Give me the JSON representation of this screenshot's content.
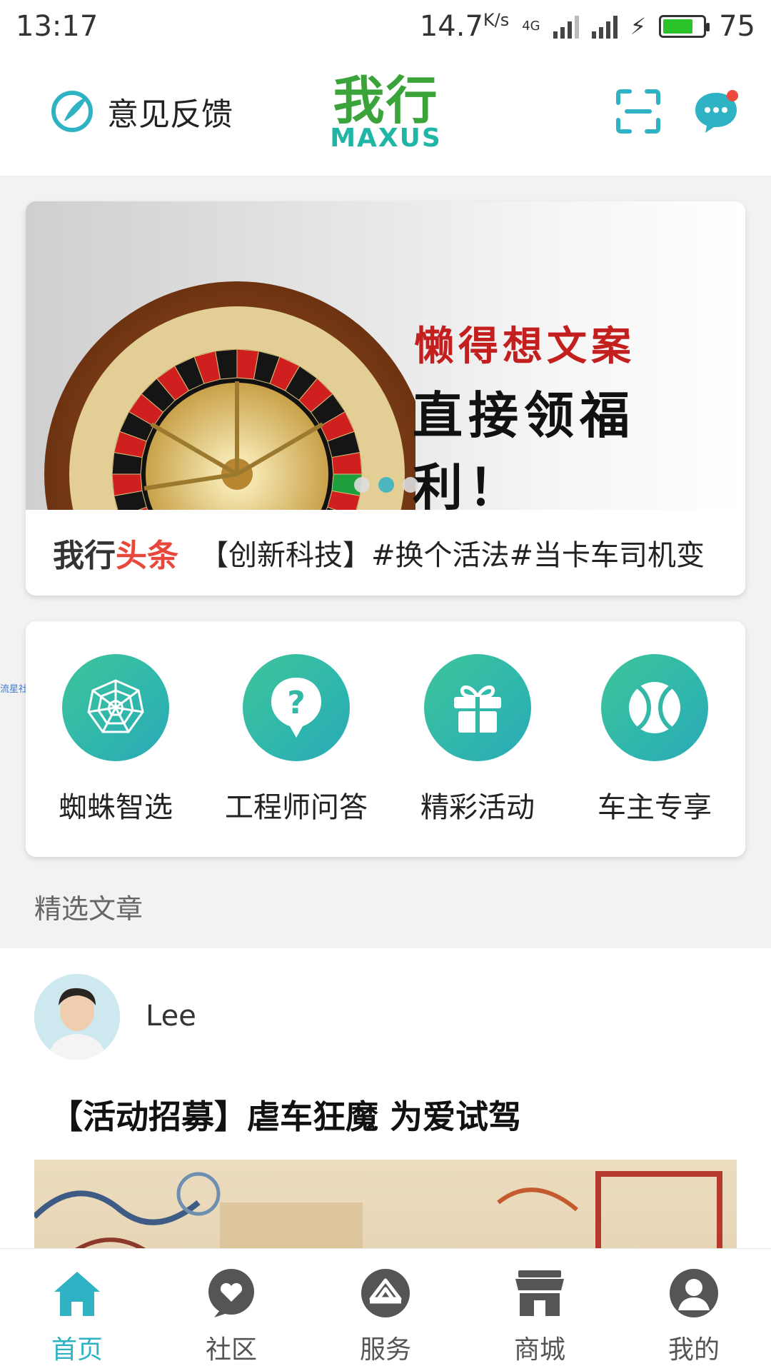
{
  "status_bar": {
    "time": "13:17",
    "net_speed": "14.7",
    "net_unit": "K/s",
    "network": "4G",
    "battery": "75",
    "battery_level": 0.75
  },
  "header": {
    "feedback_label": "意见反馈",
    "logo_cn": "我行",
    "logo_en": "MAXUS",
    "accent_color": "#2fb3c4"
  },
  "banner": {
    "line1": "懒得想文案",
    "line2": "直接领福利！",
    "active_slide": 1,
    "slide_count": 3,
    "headline_brand_1": "我行",
    "headline_brand_2": "头条",
    "headline_text": "【创新科技】#换个活法#当卡车司机变"
  },
  "shortcuts": [
    {
      "label": "蜘蛛智选",
      "icon": "spider-web-icon"
    },
    {
      "label": "工程师问答",
      "icon": "question-bubble-icon"
    },
    {
      "label": "精彩活动",
      "icon": "gift-icon"
    },
    {
      "label": "车主专享",
      "icon": "tennis-ball-icon"
    }
  ],
  "side_tag": "流星社区",
  "section_title": "精选文章",
  "article": {
    "author": "Lee",
    "title": "【活动招募】虐车狂魔 为爱试驾"
  },
  "tabs": [
    {
      "label": "首页",
      "icon": "home-icon",
      "active": true
    },
    {
      "label": "社区",
      "icon": "heart-bubble-icon",
      "active": false
    },
    {
      "label": "服务",
      "icon": "service-icon",
      "active": false
    },
    {
      "label": "商城",
      "icon": "store-icon",
      "active": false
    },
    {
      "label": "我的",
      "icon": "user-icon",
      "active": false
    }
  ]
}
